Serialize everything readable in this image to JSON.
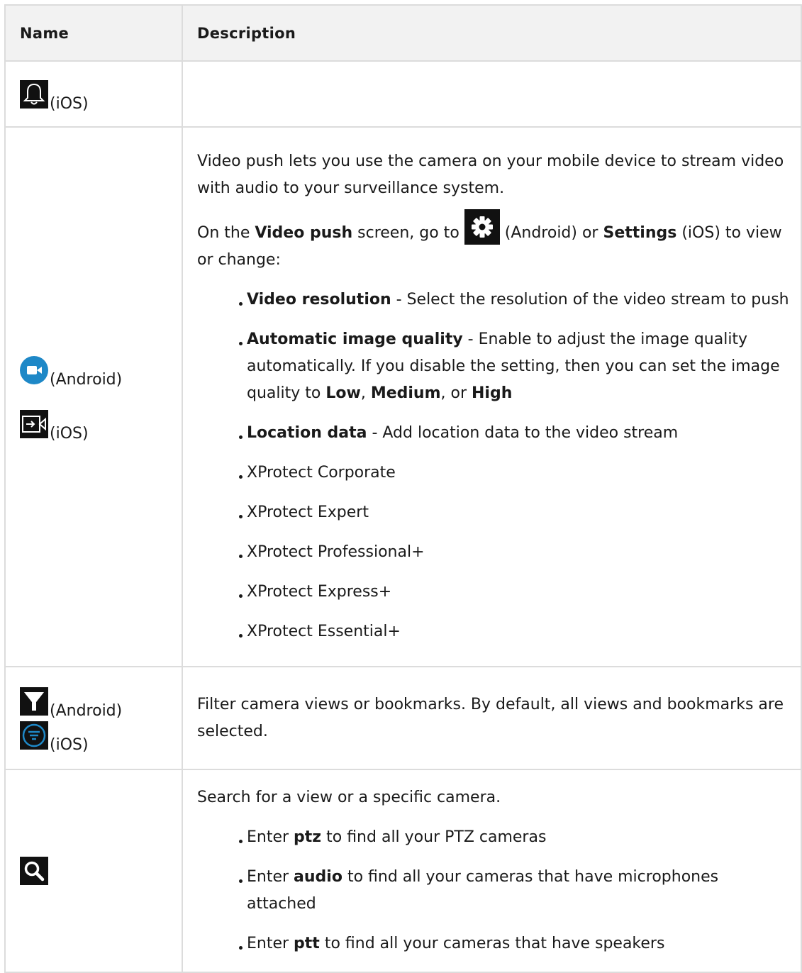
{
  "header": {
    "name": "Name",
    "description": "Description"
  },
  "rows": [
    {
      "names": [
        {
          "icon": "bell-icon",
          "label": "(iOS)"
        }
      ]
    },
    {
      "names": [
        {
          "icon": "video-camera-icon",
          "label": "(Android)"
        },
        {
          "icon": "video-push-icon",
          "label": "(iOS)"
        }
      ],
      "intro": "Video push lets you use the camera on your mobile device to stream video with audio to your surveillance system.",
      "settings_line": {
        "p1": "On the ",
        "b1": "Video push",
        "p2": " screen, go to ",
        "icon": "gear-icon",
        "p3": " (Android) or ",
        "b2": "Settings",
        "p4": " (iOS) to view or change:"
      },
      "bullets": [
        {
          "bold": "Video resolution",
          "text": " - Select the resolution of the video stream to push"
        },
        {
          "bold": "Automatic image quality",
          "text": " - Enable to adjust the image quality automatically. If you disable the setting, then you can set the image quality to ",
          "b_low": "Low",
          "sep1": ", ",
          "b_med": "Medium",
          "sep2": ", or ",
          "b_high": "High"
        },
        {
          "bold": "Location data",
          "text": " - Add location data to the video stream"
        },
        {
          "text": "XProtect Corporate"
        },
        {
          "text": "XProtect Expert"
        },
        {
          "text": "XProtect Professional+"
        },
        {
          "text": "XProtect Express+"
        },
        {
          "text": "XProtect Essential+"
        }
      ]
    },
    {
      "names": [
        {
          "icon": "filter-icon",
          "label": "(Android)"
        },
        {
          "icon": "filter-circle-icon",
          "label": "(iOS)"
        }
      ],
      "text": "Filter camera views or bookmarks. By default, all views and bookmarks are selected."
    },
    {
      "names": [
        {
          "icon": "search-icon",
          "label": ""
        }
      ],
      "intro": "Search for a view or a specific camera.",
      "bullets": [
        {
          "pre": "Enter ",
          "bold": "ptz",
          "text": " to find all your PTZ cameras"
        },
        {
          "pre": "Enter ",
          "bold": "audio",
          "text": " to find all your cameras that have microphones attached"
        },
        {
          "pre": "Enter ",
          "bold": "ptt",
          "text": " to find all your cameras that have speakers"
        }
      ]
    }
  ],
  "colors": {
    "border": "#dcdcdc",
    "header_bg": "#f2f2f2",
    "icon_blue": "#1e88c7",
    "icon_dark": "#111111"
  }
}
